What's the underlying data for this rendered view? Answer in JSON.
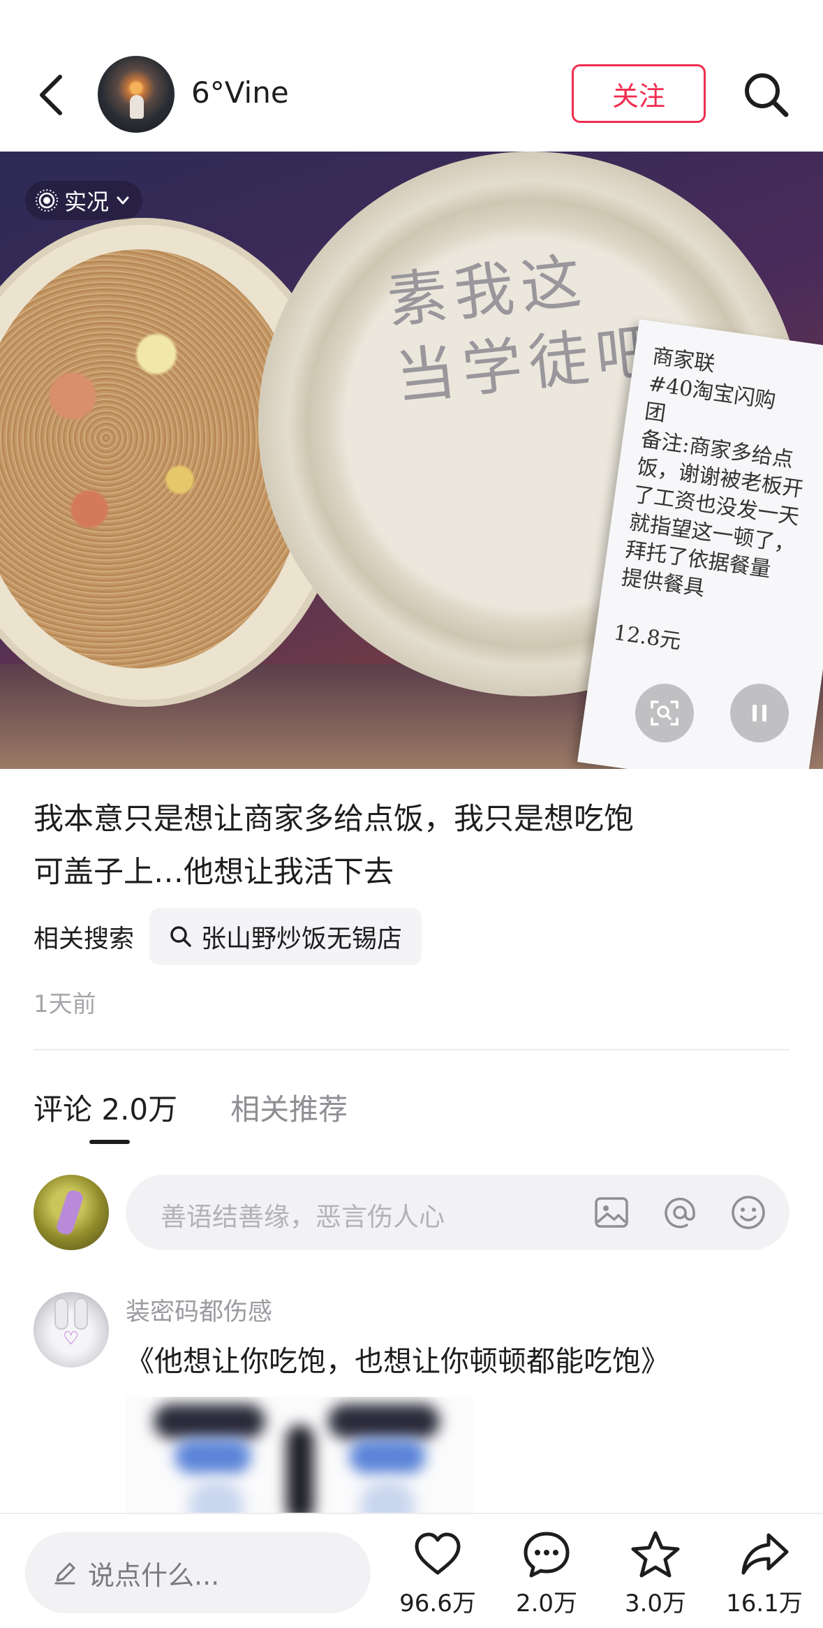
{
  "header": {
    "author_name": "6°Vine",
    "follow_label": "关注"
  },
  "media": {
    "live_label": "实况",
    "lid_text": "素我这\n当学徒吧",
    "receipt_text": "商家联\n#40淘宝闪购\n团\n备注:商家多给点\n饭，谢谢被老板开\n了工资也没发一天\n就指望这一顿了，\n拜托了依据餐量\n提供餐具\n\n12.8元"
  },
  "caption": {
    "line1": "我本意只是想让商家多给点饭，我只是想吃饱",
    "line2": "可盖子上…他想让我活下去"
  },
  "related": {
    "label": "相关搜索",
    "query": "张山野炒饭无锡店"
  },
  "post_time": "1天前",
  "tabs": [
    {
      "label": "评论 2.0万",
      "active": true
    },
    {
      "label": "相关推荐",
      "active": false
    }
  ],
  "comment_input": {
    "placeholder": "善语结善缘，恶言伤人心"
  },
  "comments": [
    {
      "user": "装密码都伤感",
      "text": "《他想让你吃饱，也想让你顿顿都能吃饱》"
    }
  ],
  "bottom_bar": {
    "placeholder": "说点什么...",
    "likes": "96.6万",
    "comments": "2.0万",
    "favorites": "3.0万",
    "shares": "16.1万"
  },
  "colors": {
    "accent": "#f02d50",
    "text_primary": "#1d1d1f",
    "text_secondary": "#a6a6ab"
  }
}
